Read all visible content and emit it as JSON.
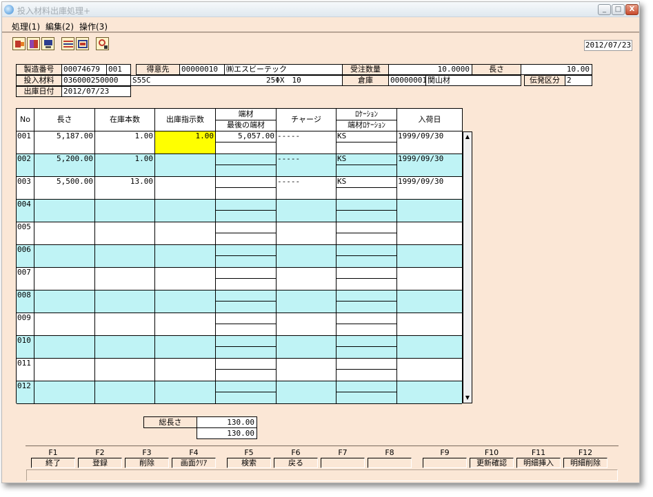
{
  "window": {
    "title": "投入材料出庫処理+",
    "min_glyph": "_",
    "max_glyph": "□",
    "close_glyph": "X"
  },
  "menu": [
    {
      "label": "処理(1)"
    },
    {
      "label": "編集(2)"
    },
    {
      "label": "操作(3)"
    }
  ],
  "toolbar": {
    "icons": [
      "exit-icon",
      "book-icon",
      "computer-icon",
      "list-icon",
      "grid-icon",
      "search-icon"
    ],
    "date": "2012/07/23"
  },
  "header": {
    "mfg_no_label": "製造番号",
    "mfg_no": "00074679",
    "mfg_sub": "001",
    "customer_label": "得意先",
    "customer_code": "00000010",
    "customer_name": "㈱エスビーテック",
    "order_qty_label": "受注数量",
    "order_qty": "10.0000",
    "length_label": "長さ",
    "length": "10.00",
    "material_label": "投入材料",
    "material_code": "036000250000",
    "material_name": "S55C",
    "material_spec": "25ΦX　10",
    "warehouse_label": "倉庫",
    "warehouse_code": "00000001",
    "warehouse_name": "関山材",
    "slip_label": "伝発区分",
    "slip_value": "2",
    "ship_date_label": "出庫日付",
    "ship_date": "2012/07/23"
  },
  "grid": {
    "headers": {
      "no": "No",
      "length": "長さ",
      "stock": "在庫本数",
      "ship_qty": "出庫指示数",
      "offcut_top": "端材",
      "offcut_bottom": "最後の端材",
      "charge": "チャージ",
      "loc_top": "ﾛｹｰｼｮﾝ",
      "loc_bottom": "端材ﾛｹｰｼｮﾝ",
      "arrival": "入荷日"
    },
    "rows": [
      {
        "no": "001",
        "length": "5,187.00",
        "stock": "1.00",
        "ship_qty": "1.00",
        "offcut": "5,057.00",
        "charge": "-----",
        "location": "KS",
        "arrival": "1999/09/30"
      },
      {
        "no": "002",
        "length": "5,200.00",
        "stock": "1.00",
        "ship_qty": "",
        "offcut": "",
        "charge": "-----",
        "location": "KS",
        "arrival": "1999/09/30"
      },
      {
        "no": "003",
        "length": "5,500.00",
        "stock": "13.00",
        "ship_qty": "",
        "offcut": "",
        "charge": "-----",
        "location": "KS",
        "arrival": "1999/09/30"
      },
      {
        "no": "004",
        "length": "",
        "stock": "",
        "ship_qty": "",
        "offcut": "",
        "charge": "",
        "location": "",
        "arrival": ""
      },
      {
        "no": "005",
        "length": "",
        "stock": "",
        "ship_qty": "",
        "offcut": "",
        "charge": "",
        "location": "",
        "arrival": ""
      },
      {
        "no": "006",
        "length": "",
        "stock": "",
        "ship_qty": "",
        "offcut": "",
        "charge": "",
        "location": "",
        "arrival": ""
      },
      {
        "no": "007",
        "length": "",
        "stock": "",
        "ship_qty": "",
        "offcut": "",
        "charge": "",
        "location": "",
        "arrival": ""
      },
      {
        "no": "008",
        "length": "",
        "stock": "",
        "ship_qty": "",
        "offcut": "",
        "charge": "",
        "location": "",
        "arrival": ""
      },
      {
        "no": "009",
        "length": "",
        "stock": "",
        "ship_qty": "",
        "offcut": "",
        "charge": "",
        "location": "",
        "arrival": ""
      },
      {
        "no": "010",
        "length": "",
        "stock": "",
        "ship_qty": "",
        "offcut": "",
        "charge": "",
        "location": "",
        "arrival": ""
      },
      {
        "no": "011",
        "length": "",
        "stock": "",
        "ship_qty": "",
        "offcut": "",
        "charge": "",
        "location": "",
        "arrival": ""
      },
      {
        "no": "012",
        "length": "",
        "stock": "",
        "ship_qty": "",
        "offcut": "",
        "charge": "",
        "location": "",
        "arrival": ""
      }
    ],
    "scroll_up": "▲",
    "scroll_down": "▼"
  },
  "totals": {
    "label": "総長さ",
    "value1": "130.00",
    "value2": "130.00"
  },
  "fkeys": [
    {
      "key": "F1",
      "label": "終了"
    },
    {
      "key": "F2",
      "label": "登録"
    },
    {
      "key": "F3",
      "label": "削除"
    },
    {
      "key": "F4",
      "label": "画面ｸﾘｱ"
    },
    {
      "key": "F5",
      "label": "検索"
    },
    {
      "key": "F6",
      "label": "戻る"
    },
    {
      "key": "F7",
      "label": ""
    },
    {
      "key": "F8",
      "label": ""
    },
    {
      "key": "F9",
      "label": ""
    },
    {
      "key": "F10",
      "label": "更新確認"
    },
    {
      "key": "F11",
      "label": "明細挿入"
    },
    {
      "key": "F12",
      "label": "明細削除"
    }
  ],
  "colors": {
    "window_bg": "#fbe7d6",
    "row_alt": "#bff3f5",
    "highlight": "#ffff00"
  }
}
